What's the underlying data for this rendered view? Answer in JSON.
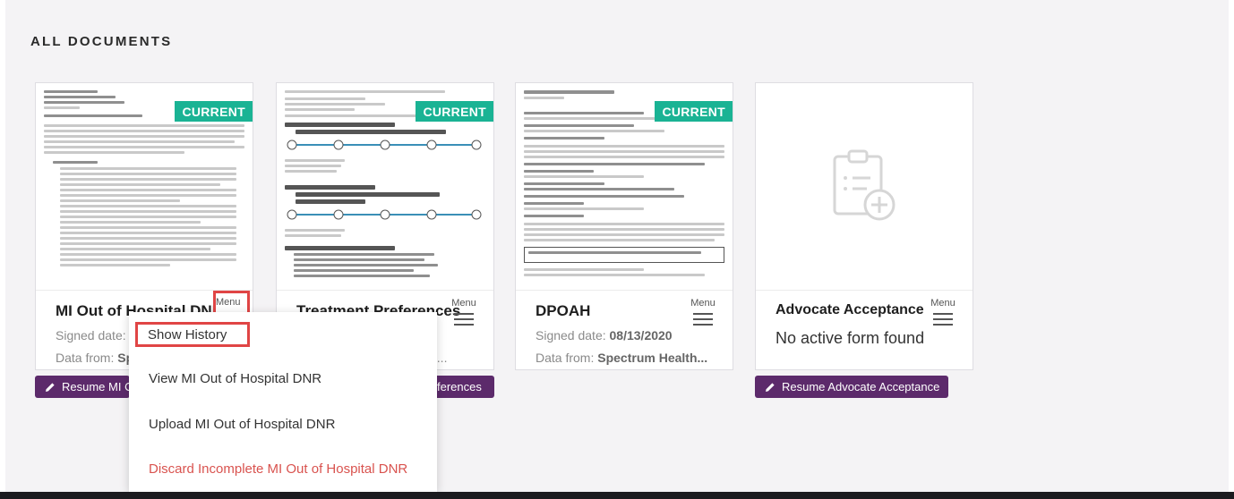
{
  "section": {
    "title": "ALL DOCUMENTS"
  },
  "cards": [
    {
      "title": "MI Out of Hospital DNR",
      "badge": "CURRENT",
      "signed_label": "Signed date:",
      "data_label": "Data from:",
      "data_value_fragment": "Sp",
      "menu_label": "Menu",
      "resume_label": "Resume MI O"
    },
    {
      "title": "Treatment Preferences",
      "badge": "CURRENT",
      "data_fragment": "lth...",
      "menu_label": "Menu",
      "resume_fragment": "ferences"
    },
    {
      "title": "DPOAH",
      "badge": "CURRENT",
      "signed_label": "Signed date:",
      "signed_value": "08/13/2020",
      "data_label": "Data from:",
      "data_value": "Spectrum Health...",
      "menu_label": "Menu"
    },
    {
      "title": "Advocate Acceptance",
      "status": "No active form found",
      "menu_label": "Menu",
      "resume_label": "Resume Advocate Acceptance",
      "icon": "clipboard-add-icon"
    }
  ],
  "dropdown": {
    "items": [
      "Show History",
      "View MI Out of Hospital DNR",
      "Upload MI Out of Hospital DNR",
      "Discard Incomplete MI Out of Hospital DNR"
    ]
  },
  "colors": {
    "badge": "#1ab394",
    "resume_button": "#5c2a6b",
    "danger": "#d9534f",
    "highlight": "#e04545"
  }
}
